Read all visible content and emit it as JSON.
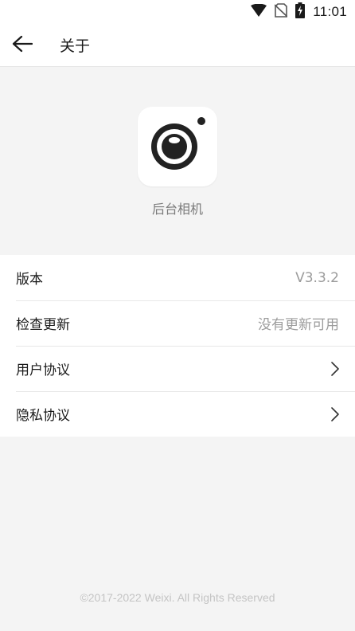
{
  "status_bar": {
    "time": "11:01",
    "icons": [
      "wifi-icon",
      "no-sim-icon",
      "battery-charging-icon"
    ]
  },
  "header": {
    "back_icon": "arrow-left-icon",
    "title": "关于"
  },
  "app": {
    "icon": "camera-lens-icon",
    "name": "后台相机"
  },
  "settings": {
    "items": [
      {
        "label": "版本",
        "value": "V3.3.2"
      },
      {
        "label": "检查更新",
        "value": "没有更新可用"
      },
      {
        "label": "用户协议",
        "icon": "chevron-right-icon"
      },
      {
        "label": "隐私协议",
        "icon": "chevron-right-icon"
      }
    ]
  },
  "footer": {
    "copyright": "©2017-2022 Weixi. All Rights Reserved"
  },
  "colors": {
    "background": "#f4f4f4",
    "surface": "#ffffff",
    "text_primary": "#1a1a1a",
    "text_secondary": "#9b9b9b",
    "icon_dark": "#222222"
  }
}
